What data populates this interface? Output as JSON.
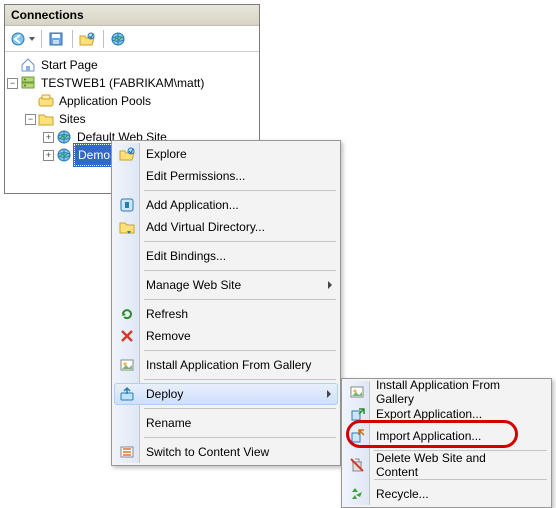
{
  "panel": {
    "title": "Connections"
  },
  "tree": {
    "startPage": "Start Page",
    "server": "TESTWEB1 (FABRIKAM\\matt)",
    "appPools": "Application Pools",
    "sites": "Sites",
    "defaultSite": "Default Web Site",
    "demoSite": "DemoSite"
  },
  "menu1": {
    "explore": "Explore",
    "editPermissions": "Edit Permissions...",
    "addApplication": "Add Application...",
    "addVirtualDir": "Add Virtual Directory...",
    "editBindings": "Edit Bindings...",
    "manageWebSite": "Manage Web Site",
    "refresh": "Refresh",
    "remove": "Remove",
    "installFromGallery": "Install Application From Gallery",
    "deploy": "Deploy",
    "rename": "Rename",
    "switchContent": "Switch to Content View"
  },
  "menu2": {
    "installFromGallery": "Install Application From Gallery",
    "exportApp": "Export Application...",
    "importApp": "Import Application...",
    "deleteSite": "Delete Web Site and Content",
    "recycle": "Recycle..."
  }
}
